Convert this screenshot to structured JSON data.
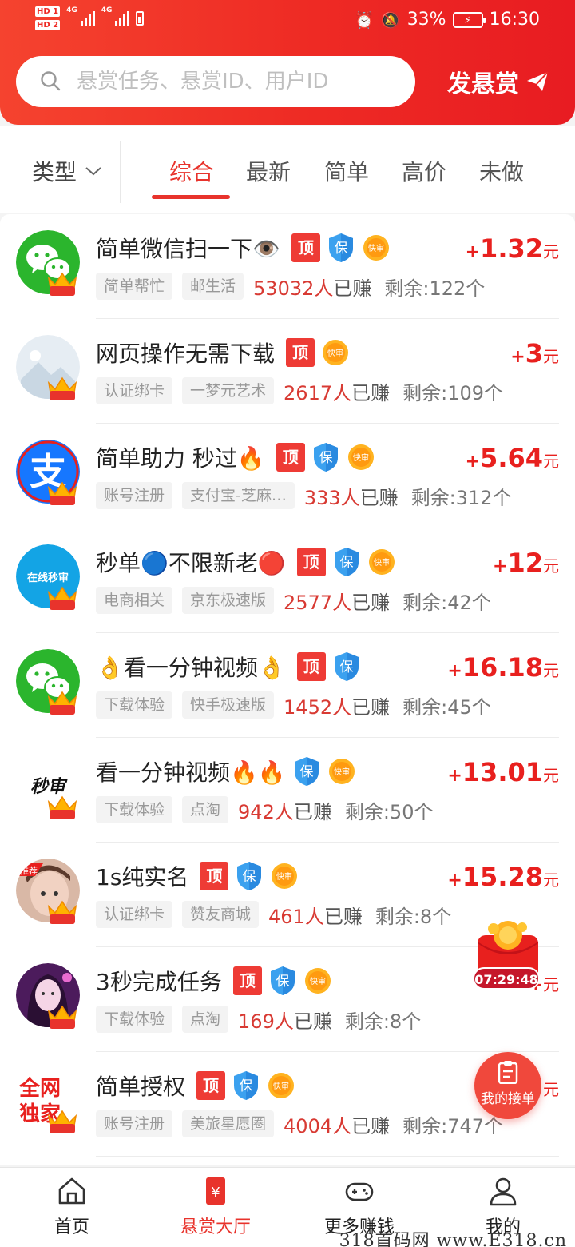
{
  "status_bar": {
    "hd1": "HD 1",
    "hd2": "HD 2",
    "net1": "4G",
    "net2": "4G",
    "battery_pct": "33%",
    "time": "16:30"
  },
  "search": {
    "placeholder": "悬赏任务、悬赏ID、用户ID"
  },
  "post_button": "发悬赏",
  "filter": {
    "type_label": "类型"
  },
  "tabs": [
    {
      "label": "综合",
      "active": true
    },
    {
      "label": "最新"
    },
    {
      "label": "简单"
    },
    {
      "label": "高价"
    },
    {
      "label": "未做"
    }
  ],
  "tasks": [
    {
      "title": "简单微信扫一下👁️",
      "badges": [
        "顶",
        "保",
        "快审"
      ],
      "reward_sign": "+",
      "reward": "1.32",
      "unit": "元",
      "tags": [
        "简单帮忙",
        "邮生活"
      ],
      "earned_num": "53032人",
      "earned_suffix": "已赚",
      "remaining": "剩余:122个",
      "avatar": "wechat",
      "crown": "半年"
    },
    {
      "title": "网页操作无需下载",
      "badges": [
        "顶",
        "快审"
      ],
      "reward_sign": "+",
      "reward": "3",
      "unit": "元",
      "tags": [
        "认证绑卡",
        "一梦元艺术"
      ],
      "earned_num": "2617人",
      "earned_suffix": "已赚",
      "remaining": "剩余:109个",
      "avatar": "placeholder",
      "crown": "年卡"
    },
    {
      "title": "简单助力  秒过🔥",
      "badges": [
        "顶",
        "保",
        "快审"
      ],
      "reward_sign": "+",
      "reward": "5.64",
      "unit": "元",
      "tags": [
        "账号注册",
        "支付宝-芝麻…"
      ],
      "earned_num": "333人",
      "earned_suffix": "已赚",
      "remaining": "剩余:312个",
      "avatar": "alipay",
      "avatar_text": "支",
      "crown": "年卡"
    },
    {
      "title": "秒单🔵不限新老🔴",
      "badges": [
        "顶",
        "保",
        "快审"
      ],
      "reward_sign": "+",
      "reward": "12",
      "unit": "元",
      "tags": [
        "电商相关",
        "京东极速版"
      ],
      "earned_num": "2577人",
      "earned_suffix": "已赚",
      "remaining": "剩余:42个",
      "avatar": "online",
      "avatar_text": "在线秒审",
      "crown": "年卡"
    },
    {
      "title": "👌看一分钟视频👌",
      "badges": [
        "顶",
        "保"
      ],
      "reward_sign": "+",
      "reward": "16.18",
      "unit": "元",
      "tags": [
        "下载体验",
        "快手极速版"
      ],
      "earned_num": "1452人",
      "earned_suffix": "已赚",
      "remaining": "剩余:45个",
      "avatar": "wechat",
      "crown": "年卡"
    },
    {
      "title": "看一分钟视频🔥🔥",
      "badges": [
        "保",
        "快审"
      ],
      "reward_sign": "+",
      "reward": "13.01",
      "unit": "元",
      "tags": [
        "下载体验",
        "点淘"
      ],
      "earned_num": "942人",
      "earned_suffix": "已赚",
      "remaining": "剩余:50个",
      "avatar": "calligraphy",
      "avatar_text": "秒审",
      "crown": "年卡"
    },
    {
      "title": "1s纯实名",
      "badges": [
        "顶",
        "保",
        "快审"
      ],
      "reward_sign": "+",
      "reward": "15.28",
      "unit": "元",
      "tags": [
        "认证绑卡",
        "赞友商城"
      ],
      "earned_num": "461人",
      "earned_suffix": "已赚",
      "remaining": "剩余:8个",
      "avatar": "photo-kid",
      "avatar_text": "推荐",
      "crown": "年卡"
    },
    {
      "title": "3秒完成任务",
      "badges": [
        "顶",
        "保",
        "快审"
      ],
      "reward_sign": "+",
      "reward": "",
      "unit": "元",
      "tags": [
        "下载体验",
        "点淘"
      ],
      "earned_num": "169人",
      "earned_suffix": "已赚",
      "remaining": "剩余:8个",
      "avatar": "photo-girl",
      "crown": "年卡"
    },
    {
      "title": "简单授权",
      "badges": [
        "顶",
        "保",
        "快审"
      ],
      "reward_sign": "",
      "reward": "",
      "unit": "元",
      "tags": [
        "账号注册",
        "美旅星愿圈"
      ],
      "earned_num": "4004人",
      "earned_suffix": "已赚",
      "remaining": "剩余:747个",
      "avatar": "text-red",
      "avatar_text": "全网独家",
      "crown": "年卡"
    }
  ],
  "float_timer": "07:29:48",
  "float_orders_label": "我的接单",
  "nav": [
    {
      "label": "首页",
      "icon": "home-icon"
    },
    {
      "label": "悬赏大厅",
      "icon": "reward-hall-icon",
      "active": true
    },
    {
      "label": "更多赚钱",
      "icon": "gamepad-icon"
    },
    {
      "label": "我的",
      "icon": "user-icon"
    }
  ],
  "watermark": "318首码网  www.E318.cn",
  "colors": {
    "brand_red": "#e8332c",
    "reward_red": "#e8201e",
    "header_red": "#ee2a24"
  }
}
